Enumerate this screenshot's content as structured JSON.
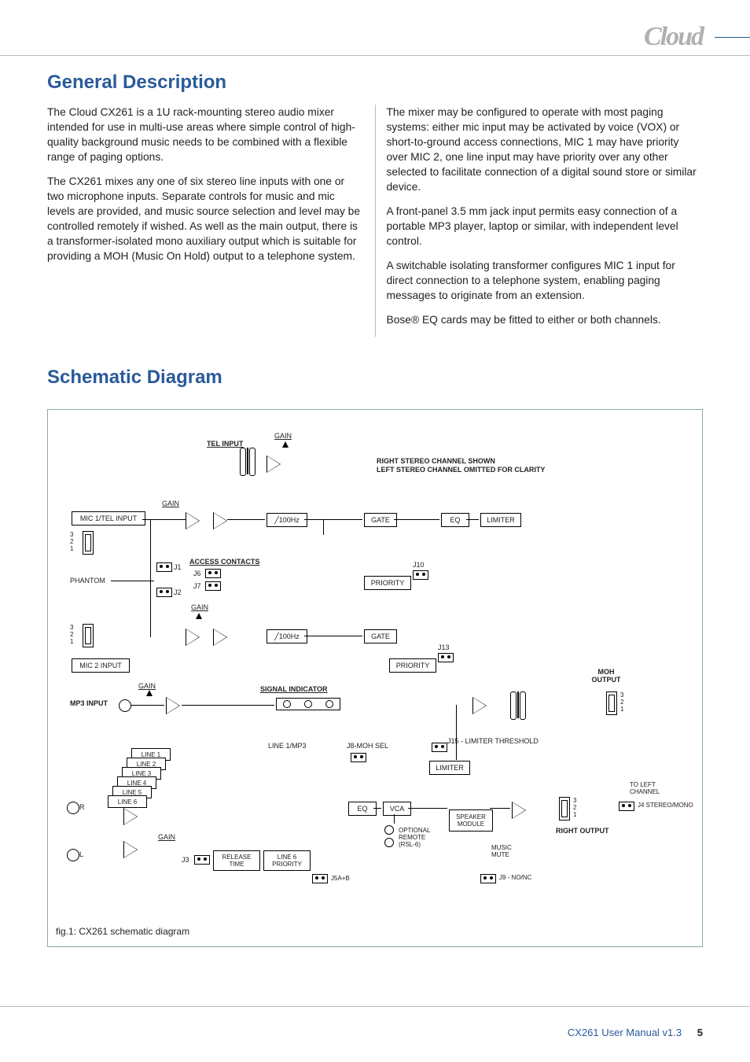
{
  "logo_text": "Cloud",
  "sections": {
    "general_description": {
      "title": "General Description",
      "p1": "The Cloud CX261 is a 1U rack-mounting stereo audio mixer intended for use in multi-use areas where simple control of high-quality background music needs to be combined with a flexible range of paging options.",
      "p2": "The CX261 mixes any one of six stereo line inputs with one or two microphone inputs. Separate controls for music and mic levels are provided, and music source selection and level may be controlled remotely if wished. As well as the main output, there is a transformer-isolated mono auxiliary output which is suitable for providing a MOH (Music On Hold) output to a telephone system.",
      "p3": "The mixer may be configured to operate with most paging systems: either mic input may be activated by voice (VOX) or short-to-ground access connections, MIC 1 may have priority over MIC 2, one line input may have priority over any other selected to facilitate connection of a digital sound store or similar device.",
      "p4": "A front-panel 3.5 mm jack input permits easy connection of a portable MP3 player, laptop or similar, with independent level control.",
      "p5": "A switchable isolating transformer configures MIC 1 input for direct connection to a telephone system, enabling paging messages to originate from an extension.",
      "p6": "Bose® EQ cards may be fitted to either or both channels."
    },
    "schematic": {
      "title": "Schematic Diagram",
      "caption": "fig.1: CX261 schematic diagram",
      "note_line1": "RIGHT STEREO CHANNEL SHOWN",
      "note_line2": "LEFT STEREO CHANNEL OMITTED FOR CLARITY",
      "labels": {
        "tel_input": "TEL INPUT",
        "gain": "GAIN",
        "mic1": "MIC 1/TEL INPUT",
        "hpf": "100Hz",
        "gate": "GATE",
        "eq": "EQ",
        "limiter": "LIMITER",
        "phantom": "PHANTOM",
        "access": "ACCESS CONTACTS",
        "j1": "J1",
        "j2": "J2",
        "j6": "J6",
        "j7": "J7",
        "j10": "J10",
        "j13": "J13",
        "priority": "PRIORITY",
        "mic2": "MIC 2 INPUT",
        "mp3": "MP3 INPUT",
        "signal_ind": "SIGNAL INDICATOR",
        "line1mp3": "LINE 1/MP3",
        "j8": "J8-MOH SEL",
        "limiter_thr": "J15 - LIMITER THRESHOLD",
        "moh": "MOH OUTPUT",
        "line1": "LINE 1",
        "line2": "LINE 2",
        "line3": "LINE 3",
        "line4": "LINE 4",
        "line5": "LINE 5",
        "line6": "LINE 6",
        "vca": "VCA",
        "speaker_mod": "SPEAKER MODULE",
        "right_out": "RIGHT OUTPUT",
        "to_left": "TO LEFT CHANNEL",
        "j4": "J4 STEREO/MONO",
        "remote": "OPTIONAL REMOTE (RSL-6)",
        "music_mute": "MUSIC MUTE",
        "release": "RELEASE TIME",
        "line6pri": "LINE 6 PRIORITY",
        "j5": "J5A+B",
        "j9": "J9 - NO/NC",
        "j3": "J3",
        "r": "R",
        "l": "L",
        "pins": "3\n2\n1"
      }
    }
  },
  "footer": {
    "title": "CX261 User Manual v1.3",
    "page": "5"
  }
}
